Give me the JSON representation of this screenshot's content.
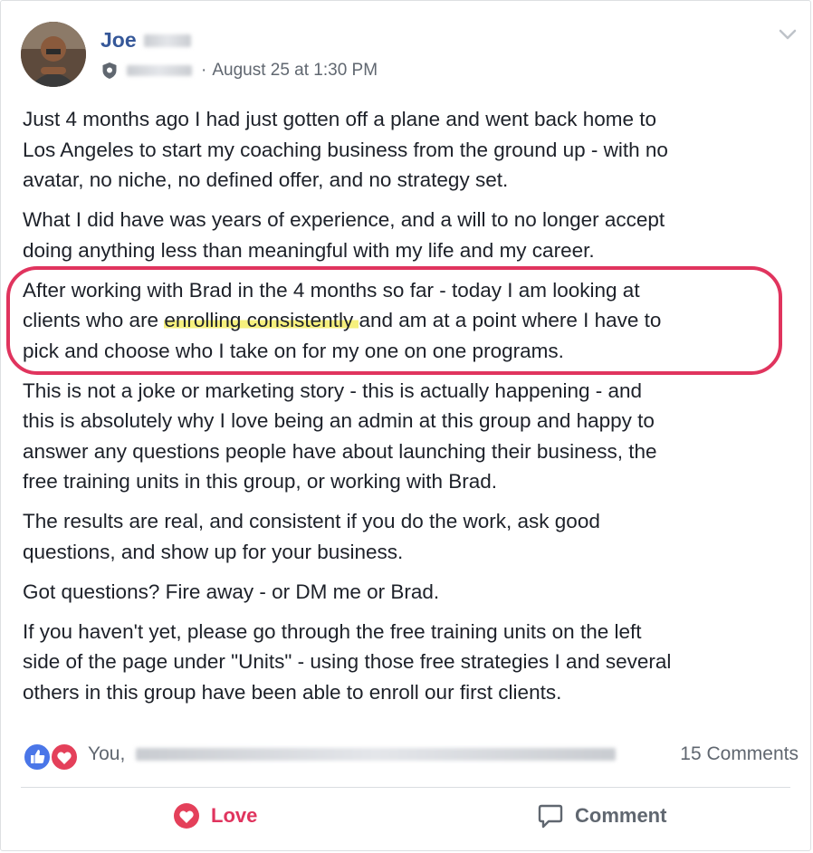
{
  "post": {
    "author_first": "Joe",
    "timestamp": "August 25 at 1:30 PM",
    "separator": "·",
    "paragraphs": [
      [
        "Just 4 months ago I had just gotten off a plane and went back home to",
        "Los Angeles to start my coaching business from the ground up - with no",
        "avatar, no niche, no defined offer, and no strategy set."
      ],
      [
        "What I did have was years of experience, and a will to no longer accept",
        "doing anything less than meaningful with my life and my career."
      ],
      [
        "After working with Brad in the 4 months so far - today I am looking at"
      ],
      [
        "This is not a joke or marketing story - this is actually happening - and",
        "this is absolutely why I love being an admin at this group and happy to",
        "answer any questions people have about launching their business, the",
        "free training units in this group, or working with Brad."
      ],
      [
        "The results are real, and consistent if you do the work, ask good",
        "questions, and show up for your business."
      ],
      [
        "Got questions? Fire away - or DM me or Brad."
      ],
      [
        "If you haven't yet, please go through the free training units on the left",
        "side of the page under \"Units\" - using those free strategies I and several",
        "others in this group have been able to enroll our first clients."
      ]
    ],
    "p3_line2_pre": "clients who are ",
    "p3_line2_highlight": "enrolling consistently ",
    "p3_line2_post": "and am at a point where I have to",
    "p3_line3": "pick and choose who I take on for my one on one programs."
  },
  "reactions": {
    "you_label": "You,",
    "comments_count": "15 Comments"
  },
  "actions": {
    "love_label": "Love",
    "comment_label": "Comment"
  },
  "colors": {
    "author_link": "#365899",
    "love": "#e0345e",
    "highlight": "#f6f07d",
    "circle_annotation": "#e0345e"
  },
  "icons": [
    "avatar",
    "admin-shield-icon",
    "chevron-down-icon",
    "like-reaction-icon",
    "love-reaction-icon",
    "heart-icon",
    "comment-bubble-icon"
  ]
}
